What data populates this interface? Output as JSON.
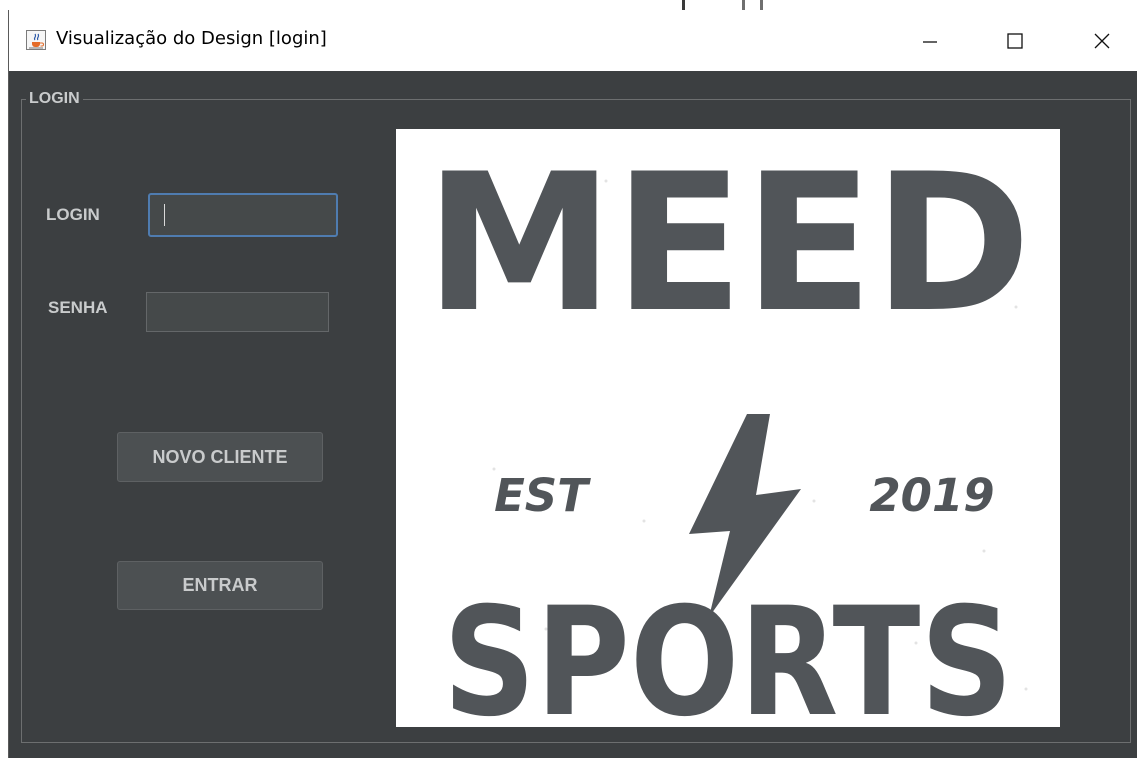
{
  "window": {
    "title": "Visualização do Design [login]",
    "buttons": {
      "minimize": "—",
      "maximize": "☐",
      "close": "✕"
    },
    "icon": "java-cup-icon"
  },
  "form": {
    "group_title": "LOGIN",
    "login_label": "LOGIN",
    "login_value": "",
    "senha_label": "SENHA",
    "senha_value": "",
    "new_client_button": "NOVO CLIENTE",
    "enter_button": "ENTRAR"
  },
  "logo": {
    "top_text": "MEED",
    "left_text": "EST",
    "right_text": "2019",
    "bottom_text": "SPORTS",
    "icon": "lightning-bolt-icon",
    "color": "#515559"
  },
  "colors": {
    "background": "#3c3f41",
    "text": "#c9cbcc",
    "focus_border": "#4f7cb0",
    "input_background": "#45494a"
  }
}
